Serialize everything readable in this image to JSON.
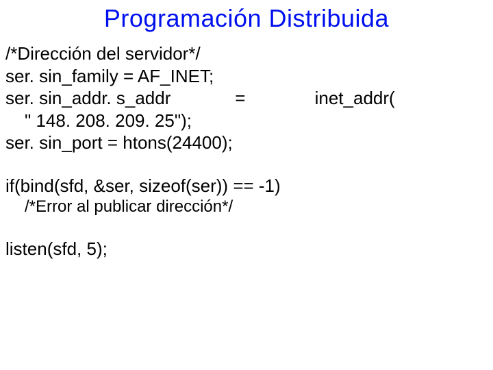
{
  "title": "Programación Distribuida",
  "lines": {
    "l1": "/*Dirección del servidor*/",
    "l2": "ser. sin_family = AF_INET;",
    "l3": "ser. sin_addr. s_addr             =              inet_addr(",
    "l4": "\" 148. 208. 209. 25\");",
    "l5": "ser. sin_port = htons(24400);",
    "l6": "if(bind(sfd, &ser, sizeof(ser)) == -1)",
    "l7": "/*Error al publicar dirección*/",
    "l8": "listen(sfd, 5);"
  }
}
